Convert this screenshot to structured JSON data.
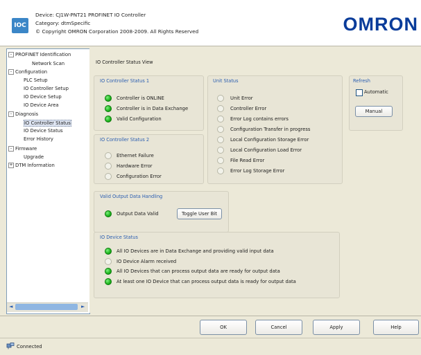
{
  "header": {
    "logo_text": "IOC",
    "device_line": "Device: CJ1W-PNT21 PROFINET IO Controller",
    "category_line": "Category: dtmSpecific",
    "copyright_line": "© Copyright OMRON Corporation 2008-2009. All Rights Reserved",
    "brand": "OMRON"
  },
  "tree": {
    "items": [
      {
        "label": "PROFINET Identification",
        "expander": "-",
        "level": 0
      },
      {
        "label": "Network Scan",
        "expander": "",
        "level": 2
      },
      {
        "label": "Configuration",
        "expander": "-",
        "level": 0
      },
      {
        "label": "PLC Setup",
        "expander": "",
        "level": 1
      },
      {
        "label": "IO Controller Setup",
        "expander": "",
        "level": 1
      },
      {
        "label": "IO Device Setup",
        "expander": "",
        "level": 1
      },
      {
        "label": "IO Device Area",
        "expander": "",
        "level": 1
      },
      {
        "label": "Diagnosis",
        "expander": "-",
        "level": 0
      },
      {
        "label": "IO Controller Status",
        "expander": "",
        "level": 1,
        "selected": true
      },
      {
        "label": "IO Device Status",
        "expander": "",
        "level": 1
      },
      {
        "label": "Error History",
        "expander": "",
        "level": 1
      },
      {
        "label": "Firmware",
        "expander": "-",
        "level": 0
      },
      {
        "label": "Upgrade",
        "expander": "",
        "level": 1
      },
      {
        "label": "DTM Information",
        "expander": "+",
        "level": 0
      }
    ],
    "scroll_left": "◄",
    "scroll_right": "►"
  },
  "main": {
    "view_title": "IO Controller Status View",
    "status1": {
      "title": "IO Controller Status 1",
      "items": [
        {
          "label": "Controller is ONLINE",
          "state": "on"
        },
        {
          "label": "Controller is in Data Exchange",
          "state": "on"
        },
        {
          "label": "Valid Configuration",
          "state": "on"
        }
      ]
    },
    "status2": {
      "title": "IO Controller Status 2",
      "items": [
        {
          "label": "Ethernet Failure",
          "state": "off"
        },
        {
          "label": "Hardware Error",
          "state": "off"
        },
        {
          "label": "Configuration Error",
          "state": "off"
        }
      ]
    },
    "unit_status": {
      "title": "Unit Status",
      "items": [
        {
          "label": "Unit Error",
          "state": "off"
        },
        {
          "label": "Controller Error",
          "state": "off"
        },
        {
          "label": "Error Log contains errors",
          "state": "off"
        },
        {
          "label": "Configuration Transfer in progress",
          "state": "off"
        },
        {
          "label": "Local Configuration Storage Error",
          "state": "off"
        },
        {
          "label": "Local Configuration Load Error",
          "state": "off"
        },
        {
          "label": "File Read Error",
          "state": "off"
        },
        {
          "label": "Error Log Storage Error",
          "state": "off"
        }
      ]
    },
    "refresh": {
      "title": "Refresh",
      "automatic_label": "Automatic",
      "automatic_checked": false,
      "manual_label": "Manual"
    },
    "valid_output": {
      "title": "Valid Output Data Handling",
      "label": "Output Data Valid",
      "state": "on",
      "toggle_label": "Toggle User Bit"
    },
    "device_status": {
      "title": "IO Device Status",
      "items": [
        {
          "label": "All IO Devices are in Data Exchange and providing valid input data",
          "state": "on"
        },
        {
          "label": "IO Device Alarm received",
          "state": "off"
        },
        {
          "label": "All IO Devices that can process output data are ready for output data",
          "state": "on"
        },
        {
          "label": "At least one IO Device that can process output data is ready for output data",
          "state": "on"
        }
      ]
    }
  },
  "footer": {
    "ok": "OK",
    "cancel": "Cancel",
    "apply": "Apply",
    "help": "Help"
  },
  "status_bar": {
    "text": "Connected",
    "icon": "network-connected-icon"
  },
  "colors": {
    "section_title": "#2a5db0",
    "led_on": "#1bb31b",
    "brand": "#0a3c9a"
  }
}
